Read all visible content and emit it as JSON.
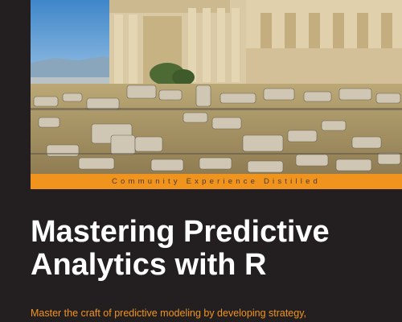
{
  "cover": {
    "tagline": "Community Experience Distilled",
    "title_line1": "Mastering Predictive",
    "title_line2": "Analytics with R",
    "subtitle": "Master the craft of predictive modeling by developing strategy,"
  },
  "colors": {
    "background": "#231f20",
    "accent": "#f0941e",
    "title": "#ffffff"
  }
}
